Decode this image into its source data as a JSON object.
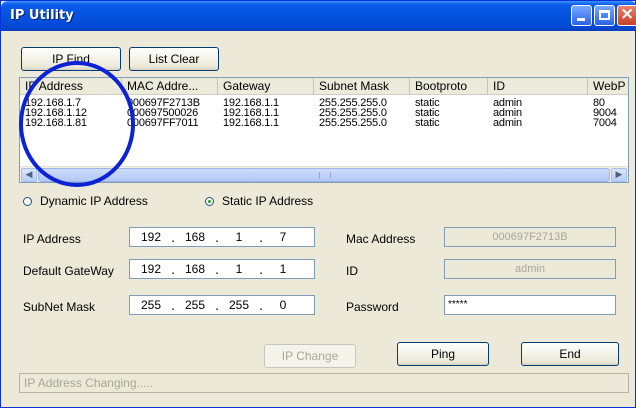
{
  "window": {
    "title": "IP Utility"
  },
  "toolbar": {
    "ip_find_label": "IP Find",
    "list_clear_label": "List Clear"
  },
  "list": {
    "columns": [
      "IP Address",
      "MAC Addre...",
      "Gateway",
      "Subnet Mask",
      "Bootproto",
      "ID",
      "WebP"
    ],
    "rows": [
      [
        "192.168.1.7",
        "000697F2713B",
        "192.168.1.1",
        "255.255.255.0",
        "static",
        "admin",
        "80"
      ],
      [
        "192.168.1.12",
        "000697500026",
        "192.168.1.1",
        "255.255.255.0",
        "static",
        "admin",
        "9004"
      ],
      [
        "192.168.1.81",
        "000697FF7011",
        "192.168.1.1",
        "255.255.255.0",
        "static",
        "admin",
        "7004"
      ]
    ]
  },
  "mode": {
    "dynamic_label": "Dynamic IP Address",
    "static_label": "Static IP Address",
    "selected": "static"
  },
  "form": {
    "ip_label": "IP Address",
    "ip": [
      "192",
      "168",
      "1",
      "7"
    ],
    "gateway_label": "Default GateWay",
    "gateway": [
      "192",
      "168",
      "1",
      "1"
    ],
    "subnet_label": "SubNet Mask",
    "subnet": [
      "255",
      "255",
      "255",
      "0"
    ],
    "mac_label": "Mac Address",
    "mac_value": "000697F2713B",
    "id_label": "ID",
    "id_value": "admin",
    "password_label": "Password",
    "password_value": "*****"
  },
  "actions": {
    "ip_change_label": "IP Change",
    "ping_label": "Ping",
    "end_label": "End"
  },
  "status": {
    "text": "IP Address Changing....."
  },
  "colors": {
    "title_bar": "#0453df",
    "annotation_circle": "#0b22d6",
    "window_bg": "#ece9d8"
  }
}
